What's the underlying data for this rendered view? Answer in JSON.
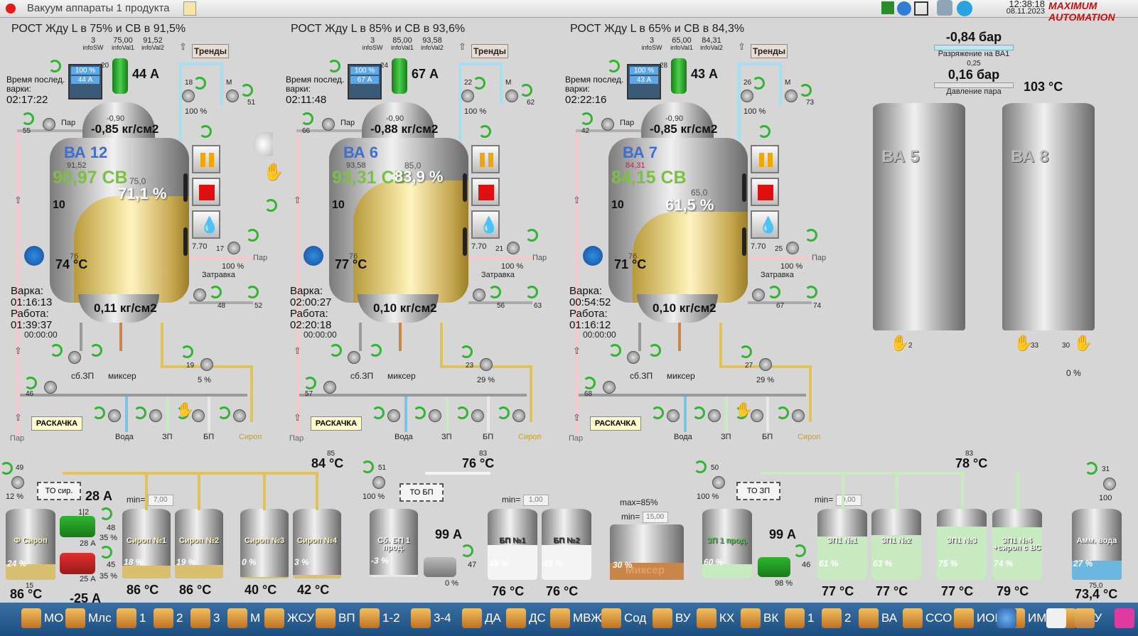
{
  "window": {
    "title": "Вакуум аппараты 1 продукта",
    "time": "12:38:18",
    "date": "08.11.2023",
    "logo": "MAXIMUM AUTOMATION"
  },
  "units": [
    {
      "header": "РОСТ Жду L в 75%  и СВ в 91,5%",
      "info": [
        {
          "v": "3",
          "l": "infoSW"
        },
        {
          "v": "75,00",
          "l": "infoVal1"
        },
        {
          "v": "91,52",
          "l": "infoVal2"
        }
      ],
      "trends": "Тренды",
      "name": "ВА 12",
      "current": "44 А",
      "meter": [
        "100 %",
        "44 А"
      ],
      "meter_num": "20",
      "last_cook_label": "Время послед. варки:",
      "last_cook": "02:17:22",
      "valve_top": "18",
      "valve_top_pct": "100 %",
      "valve_top2": "51",
      "valve_top2_label": "М",
      "vac_small": "-0,90",
      "vacuum": "-0,85 кг/см2",
      "steam_valve": "55",
      "steam_label": "Пар",
      "sv_small": "91,52",
      "sv": "90,97 СВ",
      "level_small": "75,0",
      "level": "71,1 %",
      "level_scale": "10",
      "temp_small": "76",
      "temp": "74 °C",
      "ph": "7.70",
      "valve_side": "17",
      "valve_side_pct": "100 %",
      "steam_side": "Пар",
      "zatravka": "Затравка",
      "cook_label": "Варка:",
      "cook": "01:16:13",
      "work_label": "Работа:",
      "work": "01:39:37",
      "timer": "00:00:00",
      "pressure_bottom": "0,11 кг/см2",
      "valve_b1": "48",
      "valve_b2": "52",
      "sb_label": "сб.ЗП",
      "mixer_label": "миксер",
      "valve_19": "19",
      "valve_19_pct": "5 %",
      "valve_46": "46",
      "raskachka": "РАСКАЧКА",
      "par_label": "Пар",
      "bottom_labels": [
        "Вода",
        "ЗП",
        "БП",
        "Сироп"
      ]
    },
    {
      "header": "РОСТ Жду L в 85%  и СВ в 93,6%",
      "info": [
        {
          "v": "3",
          "l": "infoSW"
        },
        {
          "v": "85,00",
          "l": "infoVal1"
        },
        {
          "v": "93,58",
          "l": "infoVal2"
        }
      ],
      "trends": "Тренды",
      "name": "ВА 6",
      "current": "67 А",
      "meter": [
        "100 %",
        "67 А"
      ],
      "meter_num": "24",
      "last_cook_label": "Время послед. варки:",
      "last_cook": "02:11:48",
      "valve_top": "22",
      "valve_top_pct": "100 %",
      "valve_top2": "62",
      "valve_top2_label": "М",
      "vac_small": "-0,90",
      "vacuum": "-0,88 кг/см2",
      "steam_valve": "66",
      "steam_label": "Пар",
      "sv_small": "93,58",
      "sv": "93,31 СВ",
      "level_small": "85,0",
      "level": "83,9 %",
      "level_scale": "10",
      "temp_small": "76",
      "temp": "77 °C",
      "ph": "7.70",
      "valve_side": "21",
      "valve_side_pct": "100 %",
      "steam_side": "Пар",
      "zatravka": "Затравка",
      "cook_label": "Варка:",
      "cook": "02:00:27",
      "work_label": "Работа:",
      "work": "02:20:18",
      "timer": "00:00:00",
      "pressure_bottom": "0,10 кг/см2",
      "valve_b1": "56",
      "valve_b2": "63",
      "sb_label": "сб.ЗП",
      "mixer_label": "миксер",
      "valve_19": "23",
      "valve_19_pct": "29 %",
      "valve_46": "57",
      "raskachka": "РАСКАЧКА",
      "par_label": "Пар",
      "bottom_labels": [
        "Вода",
        "ЗП",
        "БП",
        "Сироп"
      ]
    },
    {
      "header": "РОСТ Жду L в 65%  и СВ в 84,3%",
      "info": [
        {
          "v": "3",
          "l": "infoSW"
        },
        {
          "v": "65,00",
          "l": "infoVal1"
        },
        {
          "v": "84,31",
          "l": "infoVal2"
        }
      ],
      "trends": "Тренды",
      "name": "ВА 7",
      "current": "43 А",
      "meter": [
        "100 %",
        "43 А"
      ],
      "meter_num": "28",
      "last_cook_label": "Время послед. варки:",
      "last_cook": "02:22:16",
      "valve_top": "26",
      "valve_top_pct": "100 %",
      "valve_top2": "73",
      "valve_top2_label": "М",
      "vac_small": "-0,90",
      "vacuum": "-0,85 кг/см2",
      "steam_valve": "42",
      "steam_label": "Пар",
      "sv_small": "84,31",
      "sv": "84,15 СВ",
      "level_small": "65,0",
      "level": "61,5 %",
      "level_scale": "10",
      "temp_small": "76",
      "temp": "71 °C",
      "ph": "7.70",
      "valve_side": "25",
      "valve_side_pct": "100 %",
      "steam_side": "Пар",
      "zatravka": "Затравка",
      "cook_label": "Варка:",
      "cook": "00:54:52",
      "work_label": "Работа:",
      "work": "01:16:12",
      "timer": "00:00:00",
      "pressure_bottom": "0,10 кг/см2",
      "valve_b1": "67",
      "valve_b2": "74",
      "sb_label": "сб.ЗП",
      "mixer_label": "миксер",
      "valve_19": "27",
      "valve_19_pct": "29 %",
      "valve_46": "68",
      "raskachka": "РАСКАЧКА",
      "par_label": "Пар",
      "bottom_labels": [
        "Вода",
        "ЗП",
        "БП",
        "Сироп"
      ]
    }
  ],
  "right_panel": {
    "vac_value": "-0,84 бар",
    "vac_label": "Разряжение на ВА1",
    "steam_small": "0,25",
    "steam_value": "0,16 бар",
    "steam_label": "Давление пара",
    "temp": "103 °C",
    "tank1_name": "ВА 5",
    "tank1_valve": "2",
    "tank2_name": "ВА 8",
    "tank2_valve1": "33",
    "tank2_valve2": "30",
    "tank2_pct": "0 %"
  },
  "bottom": {
    "syrup": {
      "valve": "49",
      "valve_pct": "12 %",
      "to_label": "ТО сир.",
      "current": "28 А",
      "temp_small": "85",
      "temp_top": "84 °C",
      "f_tank": "Ф Сироп",
      "f_pct": "24 %",
      "f_small": "15",
      "f_temp": "86 °C",
      "pump1": "1|2",
      "pump1_a": "28 А",
      "pump1_valve": "48",
      "pump1_pct": "35 %",
      "pump2_a": "25 А",
      "pump2_valve": "45",
      "pump2_pct": "35 %",
      "pump_bottom": "-25 А",
      "min_label": "min=",
      "min_value": "7,00",
      "tanks": [
        {
          "name": "Сироп №1",
          "pct": "18 %",
          "temp": "86 °C"
        },
        {
          "name": "Сироп №2",
          "pct": "19 %",
          "temp": "86 °C"
        },
        {
          "name": "Сироп №3",
          "pct": "0 %",
          "temp": "40 °C"
        },
        {
          "name": "Сироп №4",
          "pct": "3 %",
          "temp": "42 °C"
        }
      ]
    },
    "bp": {
      "valve": "51",
      "valve_pct": "100 %",
      "to_label": "ТО БП",
      "temp_small": "83",
      "temp_top": "76 °C",
      "sb_tank": "Сб. БП 1 прод.",
      "sb_pct": "-3 %",
      "current": "99 А",
      "pump_valve": "47",
      "pump_pct": "0 %",
      "min_label": "min=",
      "min_value": "1,00",
      "tanks": [
        {
          "name": "БП №1",
          "pct": "49 %",
          "temp": "76 °C"
        },
        {
          "name": "БП №2",
          "pct": "49 %",
          "temp": "76 °C"
        }
      ]
    },
    "mixer": {
      "max_label": "max=85%",
      "min_label": "min=",
      "min_value": "15,00",
      "name": "Миксер",
      "pct": "30 %"
    },
    "zp": {
      "valve": "50",
      "valve_pct": "100 %",
      "to_label": "ТО ЗП",
      "temp_small": "83",
      "temp_top": "78 °C",
      "sb_tank": "ЗП 1 прод.",
      "sb_pct": "60 %",
      "current": "99 А",
      "pump_valve": "46",
      "pump_pct": "98 %",
      "min_label": "min=",
      "min_value": "0,00",
      "tanks": [
        {
          "name": "ЗП1 №1",
          "pct": "61 %",
          "temp": "77 °C"
        },
        {
          "name": "ЗП1 №2",
          "pct": "63 %",
          "temp": "77 °C"
        },
        {
          "name": "ЗП1 №3",
          "pct": "75 %",
          "temp": "77 °C"
        },
        {
          "name": "ЗП1 №4 +сироп с ВС",
          "pct": "74 %",
          "temp": "79 °C"
        }
      ]
    },
    "amm": {
      "valve": "31",
      "valve_pct": "100",
      "name": "Амм. вода",
      "pct": "27 %",
      "small": "75,0",
      "temp": "73,4 °C"
    }
  },
  "taskbar": [
    "МО",
    "Млс",
    "1",
    "2",
    "3",
    "М",
    "ЖСУ",
    "ВП",
    "1-2",
    "3-4",
    "ДА",
    "ДС",
    "МВЖ",
    "Сод",
    "ВУ",
    "КХ",
    "ВК",
    "1",
    "2",
    "ВА",
    "ССО",
    "ИОП",
    "ИМЛ",
    "ВКУ"
  ]
}
